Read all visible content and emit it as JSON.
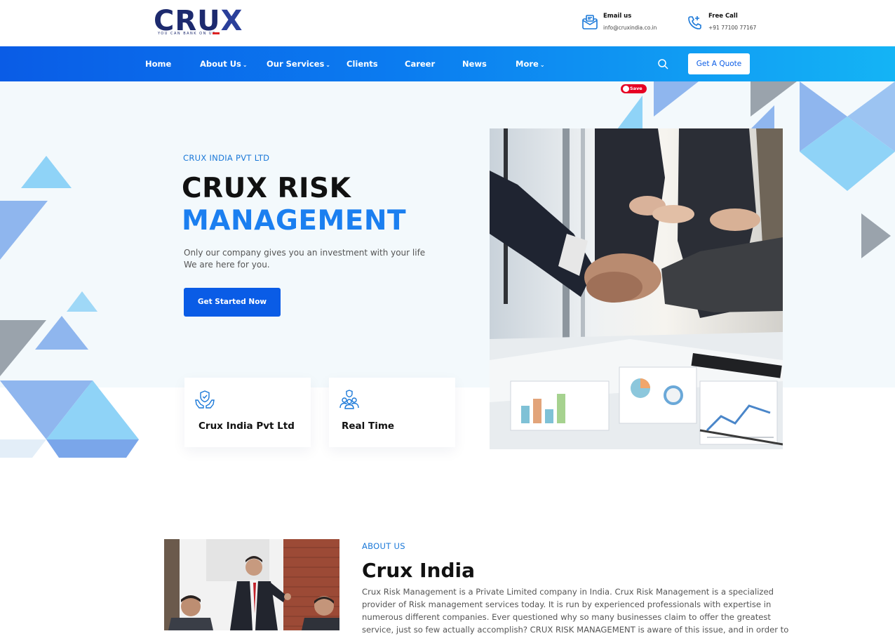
{
  "brand": {
    "logo_text_a": "CRU",
    "logo_text_b": "X",
    "tagline": "YOU CAN BANK ON US"
  },
  "header": {
    "email": {
      "title": "Email us",
      "value": "info@cruxindia.co.in",
      "icon": "email-icon"
    },
    "phone": {
      "title": "Free Call",
      "value": "+91 77100 77167",
      "icon": "phone-icon"
    }
  },
  "nav": {
    "items": [
      {
        "label": "Home",
        "has_dropdown": false
      },
      {
        "label": "About Us",
        "has_dropdown": true
      },
      {
        "label": "Our Services",
        "has_dropdown": true
      },
      {
        "label": "Clients",
        "has_dropdown": false
      },
      {
        "label": "Career",
        "has_dropdown": false
      },
      {
        "label": "News",
        "has_dropdown": false
      },
      {
        "label": "More",
        "has_dropdown": true
      }
    ],
    "chevron": "⌄",
    "search_icon": "search-icon",
    "quote_button": "Get A Quote"
  },
  "pinterest": {
    "label": "Save"
  },
  "hero": {
    "eyebrow": "CRUX INDIA PVT LTD",
    "title_line1": "CRUX RISK",
    "title_line2": "MANAGEMENT",
    "lead_line1": "Only our company gives you an investment with your life",
    "lead_line2": "We are here for you.",
    "cta": "Get Started Now",
    "cards": [
      {
        "label": "Crux India Pvt Ltd",
        "icon": "shield-hands-icon"
      },
      {
        "label": "Real Time",
        "icon": "team-icon"
      }
    ]
  },
  "about": {
    "eyebrow": "ABOUT US",
    "title": "Crux India",
    "lines": [
      "Crux Risk Management is a Private Limited company in India. Crux Risk Management is a specialized",
      "provider of Risk management services today. It is run by experienced professionals with expertise in",
      "numerous different companies. Ever questioned why so many businesses claim to offer the greatest",
      "service, just so few actually accomplish? CRUX RISK MANAGEMENT is aware of this issue, and in order to"
    ]
  },
  "colors": {
    "primary": "#0a5ce6",
    "accent": "#1b7ff0",
    "nav_end": "#14b4f5",
    "hero_bg": "#f3f9fc"
  }
}
